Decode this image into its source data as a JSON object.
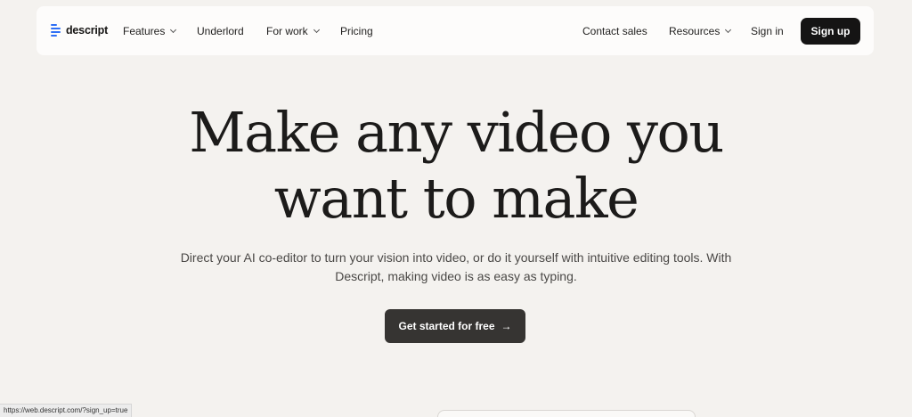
{
  "nav": {
    "logo_text": "descript",
    "items": [
      {
        "label": "Features"
      },
      {
        "label": "Underlord"
      },
      {
        "label": "For work"
      },
      {
        "label": "Pricing"
      }
    ],
    "right_items": [
      {
        "label": "Contact sales"
      },
      {
        "label": "Resources"
      },
      {
        "label": "Sign in"
      }
    ],
    "signup_label": "Sign up"
  },
  "hero": {
    "title_line1": "Make any video you",
    "title_line2": "want to make",
    "subtitle": "Direct your AI co-editor to turn your vision into video, or do it yourself with intuitive editing tools. With Descript, making video is as easy as typing.",
    "cta_label": "Get started for free",
    "cta_icon": "→"
  },
  "status_bar": {
    "url": "https://web.descript.com/?sign_up=true"
  },
  "colors": {
    "background": "#f4f2ef",
    "brand_blue": "#2f6ff5",
    "signup_bg": "#151414",
    "cta_bg": "#363432"
  }
}
